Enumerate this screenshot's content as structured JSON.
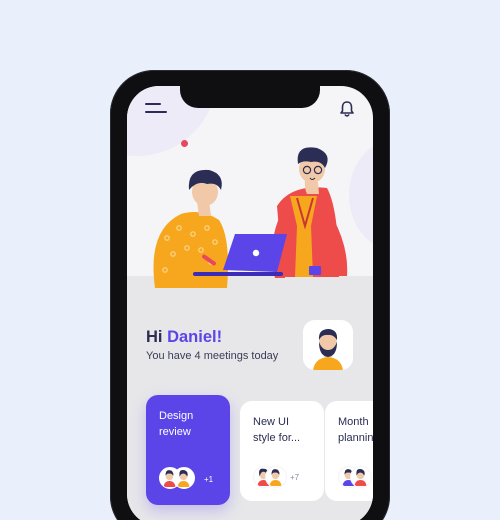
{
  "header": {
    "menu_icon": "hamburger-menu-icon",
    "notification_icon": "bell-icon"
  },
  "greeting": {
    "hi": "Hi",
    "name": "Daniel!",
    "subtitle": "You have 4 meetings today"
  },
  "meetings": [
    {
      "title": "Design review",
      "extra_count": "+1"
    },
    {
      "title": "New UI style for...",
      "extra_count": "+7"
    },
    {
      "title": "Month planning",
      "extra_count": ""
    }
  ],
  "colors": {
    "accent": "#5b45e8",
    "text_dark": "#2b2d55",
    "background": "#e9effb",
    "dot": "#e8475f"
  }
}
